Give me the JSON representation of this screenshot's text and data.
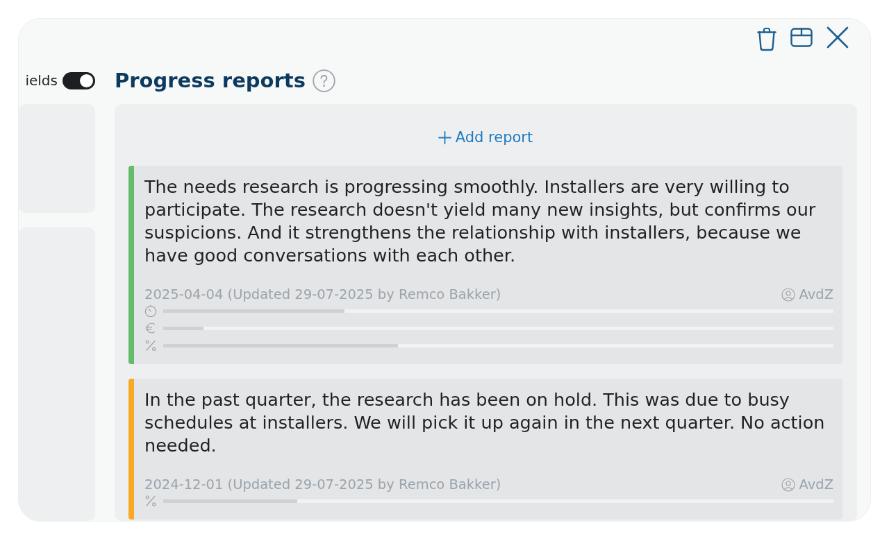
{
  "filter_toggle": {
    "label": "ields",
    "on": true
  },
  "section": {
    "title": "Progress reports",
    "add_label": "Add report"
  },
  "reports": [
    {
      "color": "#66bb6a",
      "text": "The needs research is progressing smoothly. Installers are very willing to participate. The research doesn't yield many new insights, but confirms our suspicions. And it strengthens the relationship with installers, because we have good conversations with each other.",
      "meta": "2025-04-04 (Updated 29-07-2025 by Remco Bakker)",
      "author": "AvdZ",
      "meters": [
        {
          "kind": "time",
          "level": 0.27
        },
        {
          "kind": "cost",
          "level": 0.06
        },
        {
          "kind": "progress",
          "level": 0.35
        }
      ]
    },
    {
      "color": "#f9a825",
      "text": "In the past quarter, the research has been on hold. This was due to busy schedules at installers. We will pick it up again in the next quarter. No action needed.",
      "meta": "2024-12-01 (Updated 29-07-2025 by Remco Bakker)",
      "author": "AvdZ",
      "meters": [
        {
          "kind": "progress",
          "level": 0.2
        }
      ]
    }
  ]
}
